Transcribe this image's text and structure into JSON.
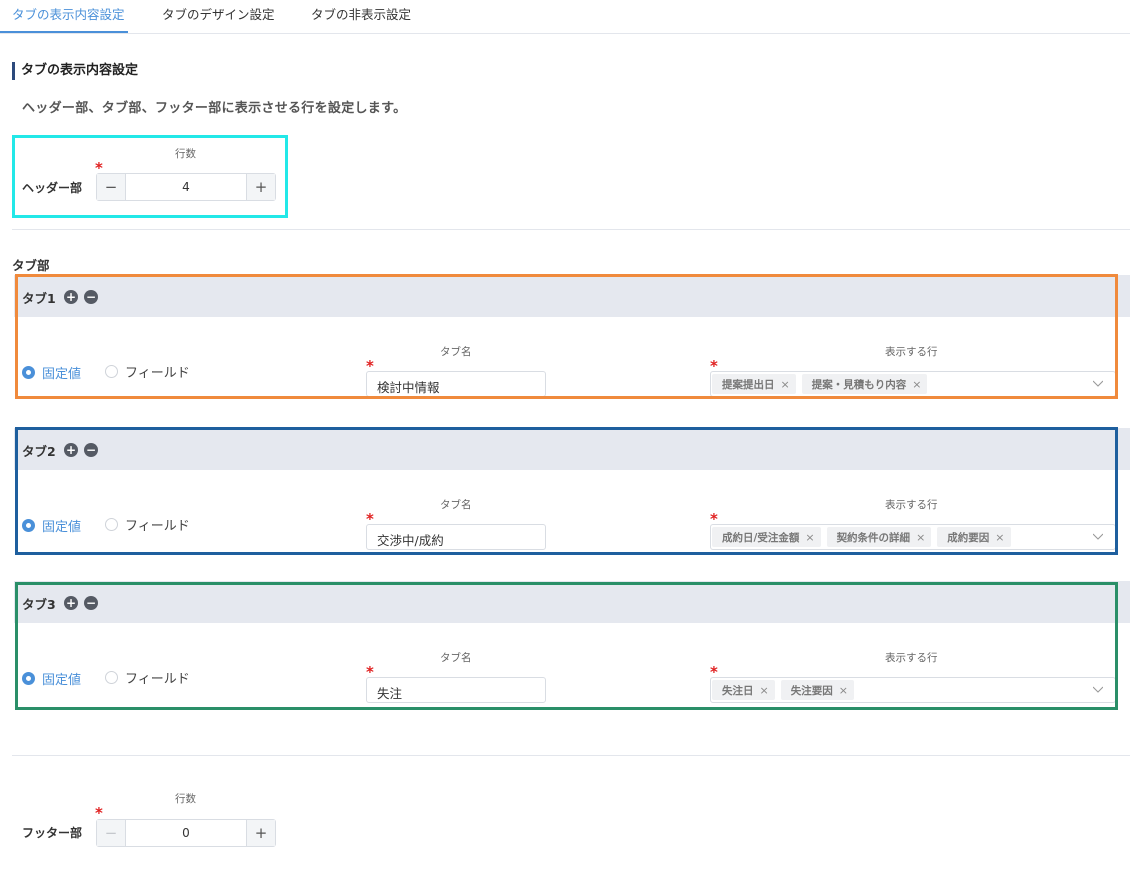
{
  "tabs": [
    {
      "label": "タブの表示内容設定",
      "active": true
    },
    {
      "label": "タブのデザイン設定",
      "active": false
    },
    {
      "label": "タブの非表示設定",
      "active": false
    }
  ],
  "section": {
    "title": "タブの表示内容設定",
    "description": "ヘッダー部、タブ部、フッター部に表示させる行を設定します。"
  },
  "header_part": {
    "label": "ヘッダー部",
    "count_label": "行数",
    "required_mark": "*",
    "value": "4",
    "minus": "−",
    "plus": "+"
  },
  "tab_part": {
    "label": "タブ部",
    "add_symbol": "+",
    "remove_symbol": "−",
    "radio_fixed": "固定値",
    "radio_field": "フィールド",
    "name_title": "タブ名",
    "rows_title": "表示する行",
    "required_mark": "*",
    "remove_chip": "×",
    "items": [
      {
        "title": "タブ1",
        "name": "検討中情報",
        "rows": [
          "提案提出日",
          "提案・見積もり内容"
        ]
      },
      {
        "title": "タブ2",
        "name": "交渉中/成約",
        "rows": [
          "成約日/受注金額",
          "契約条件の詳細",
          "成約要因"
        ]
      },
      {
        "title": "タブ3",
        "name": "失注",
        "rows": [
          "失注日",
          "失注要因"
        ]
      }
    ]
  },
  "footer_part": {
    "label": "フッター部",
    "count_label": "行数",
    "required_mark": "*",
    "value": "0",
    "minus": "−",
    "plus": "+"
  },
  "colors": {
    "accent": "#4a90d9",
    "highlight_cyan": "#22e8e8",
    "highlight_orange": "#f08a3c",
    "highlight_blue": "#1e5f9e",
    "highlight_green": "#2a8f68"
  }
}
